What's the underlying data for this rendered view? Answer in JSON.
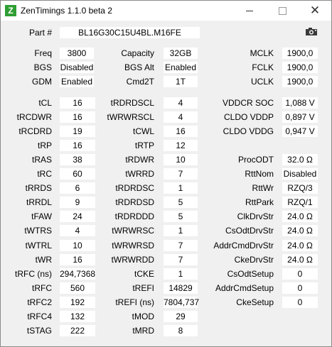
{
  "window": {
    "title": "ZenTimings 1.1.0 beta 2",
    "icon": "Z",
    "icon_color": "#2f9e33"
  },
  "part": {
    "label": "Part #",
    "value": "BL16G30C15U4BL.M16FE"
  },
  "info": [
    {
      "label": "Freq",
      "value": "3800"
    },
    {
      "label": "BGS",
      "value": "Disabled"
    },
    {
      "label": "GDM",
      "value": "Enabled"
    },
    {
      "label": "Capacity",
      "value": "32GB"
    },
    {
      "label": "BGS Alt",
      "value": "Enabled"
    },
    {
      "label": "Cmd2T",
      "value": "1T"
    },
    {
      "label": "MCLK",
      "value": "1900,0"
    },
    {
      "label": "FCLK",
      "value": "1900,0"
    },
    {
      "label": "UCLK",
      "value": "1900,0"
    }
  ],
  "col1": [
    {
      "label": "tCL",
      "value": "16"
    },
    {
      "label": "tRCDWR",
      "value": "16"
    },
    {
      "label": "tRCDRD",
      "value": "19"
    },
    {
      "label": "tRP",
      "value": "16"
    },
    {
      "label": "tRAS",
      "value": "38"
    },
    {
      "label": "tRC",
      "value": "60"
    },
    {
      "label": "tRRDS",
      "value": "6"
    },
    {
      "label": "tRRDL",
      "value": "9"
    },
    {
      "label": "tFAW",
      "value": "24"
    },
    {
      "label": "tWTRS",
      "value": "4"
    },
    {
      "label": "tWTRL",
      "value": "10"
    },
    {
      "label": "tWR",
      "value": "16"
    },
    {
      "label": "tRFC (ns)",
      "value": "294,7368"
    },
    {
      "label": "tRFC",
      "value": "560"
    },
    {
      "label": "tRFC2",
      "value": "192"
    },
    {
      "label": "tRFC4",
      "value": "132"
    },
    {
      "label": "tSTAG",
      "value": "222"
    }
  ],
  "col2": [
    {
      "label": "tRDRDSCL",
      "value": "4"
    },
    {
      "label": "tWRWRSCL",
      "value": "4"
    },
    {
      "label": "tCWL",
      "value": "16"
    },
    {
      "label": "tRTP",
      "value": "12"
    },
    {
      "label": "tRDWR",
      "value": "10"
    },
    {
      "label": "tWRRD",
      "value": "7"
    },
    {
      "label": "tRDRDSC",
      "value": "1"
    },
    {
      "label": "tRDRDSD",
      "value": "5"
    },
    {
      "label": "tRDRDDD",
      "value": "5"
    },
    {
      "label": "tWRWRSC",
      "value": "1"
    },
    {
      "label": "tWRWRSD",
      "value": "7"
    },
    {
      "label": "tWRWRDD",
      "value": "7"
    },
    {
      "label": "tCKE",
      "value": "1"
    },
    {
      "label": "tREFI",
      "value": "14829"
    },
    {
      "label": "tREFI (ns)",
      "value": "7804,737"
    },
    {
      "label": "tMOD",
      "value": "29"
    },
    {
      "label": "tMRD",
      "value": "8"
    }
  ],
  "col3": [
    {
      "label": "VDDCR SOC",
      "value": "1,088 V"
    },
    {
      "label": "CLDO VDDP",
      "value": "0,897 V"
    },
    {
      "label": "CLDO VDDG",
      "value": "0,947 V"
    },
    {
      "label": "ProcODT",
      "value": "32.0 Ω"
    },
    {
      "label": "RttNom",
      "value": "Disabled"
    },
    {
      "label": "RttWr",
      "value": "RZQ/3"
    },
    {
      "label": "RttPark",
      "value": "RZQ/1"
    },
    {
      "label": "ClkDrvStr",
      "value": "24.0 Ω"
    },
    {
      "label": "CsOdtDrvStr",
      "value": "24.0 Ω"
    },
    {
      "label": "AddrCmdDrvStr",
      "value": "24.0 Ω"
    },
    {
      "label": "CkeDrvStr",
      "value": "24.0 Ω"
    },
    {
      "label": "CsOdtSetup",
      "value": "0"
    },
    {
      "label": "AddrCmdSetup",
      "value": "0"
    },
    {
      "label": "CkeSetup",
      "value": "0"
    }
  ],
  "icons": {
    "screenshot": "camera-icon",
    "minimize": "minimize-icon",
    "maximize": "maximize-icon",
    "close": "close-icon"
  }
}
